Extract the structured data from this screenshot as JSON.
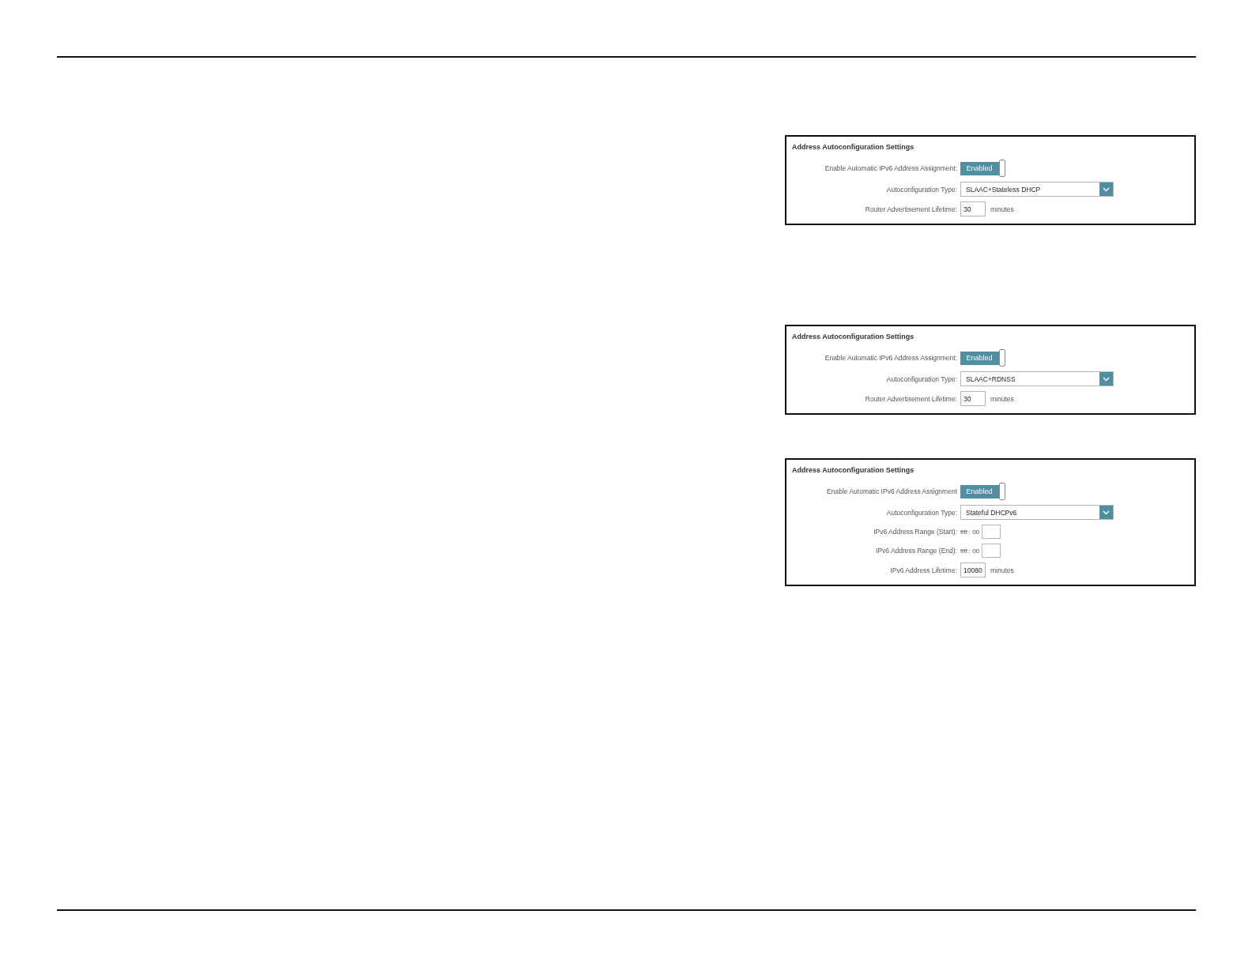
{
  "panels": [
    {
      "title": "Address Autoconfiguration Settings",
      "fields": [
        {
          "kind": "toggle",
          "label": "Enable Automatic IPv6 Address Assignment:",
          "text": "Enabled",
          "on": true
        },
        {
          "kind": "dropdown",
          "label": "Autoconfiguration Type:",
          "value": "SLAAC+Stateless DHCP"
        },
        {
          "kind": "number",
          "label": "Router Advertisement Lifetime:",
          "value": "30",
          "unit": "minutes"
        }
      ]
    },
    {
      "title": "Address Autoconfiguration Settings",
      "fields": [
        {
          "kind": "toggle",
          "label": "Enable Automatic IPv6 Address Assignment:",
          "text": "Enabled",
          "on": true
        },
        {
          "kind": "dropdown",
          "label": "Autoconfiguration Type:",
          "value": "SLAAC+RDNSS"
        },
        {
          "kind": "number",
          "label": "Router Advertisement Lifetime:",
          "value": "30",
          "unit": "minutes"
        }
      ]
    },
    {
      "title": "Address Autoconfiguration Settings",
      "fields": [
        {
          "kind": "toggle",
          "label": "Enable Automatic IPv6 Address Assignment",
          "text": "Enabled",
          "on": true
        },
        {
          "kind": "dropdown",
          "label": "Autoconfiguration Type:",
          "value": "Stateful DHCPv6"
        },
        {
          "kind": "range",
          "label": "IPv6 Address Range (Start):",
          "prefix": "ffff:: 00"
        },
        {
          "kind": "range",
          "label": "IPv6 Address Range (End):",
          "prefix": "ffff:: 00"
        },
        {
          "kind": "number",
          "label": "IPv6 Address Lifetime:",
          "value": "10080",
          "unit": "minutes"
        }
      ]
    }
  ]
}
